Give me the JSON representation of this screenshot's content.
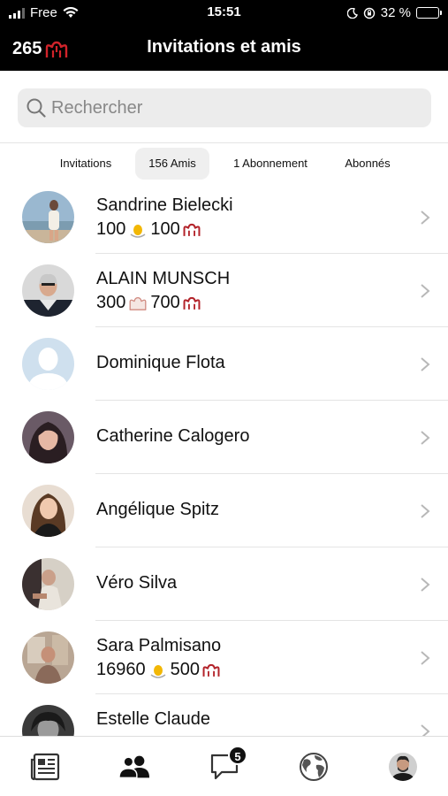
{
  "status_bar": {
    "carrier": "Free",
    "time": "15:51",
    "battery_percent": "32 %",
    "battery_level": 0.32
  },
  "header": {
    "coin_count": "265",
    "title": "Invitations et amis"
  },
  "search": {
    "placeholder": "Rechercher",
    "value": ""
  },
  "tabs": [
    {
      "label": "Invitations",
      "active": false
    },
    {
      "label": "156 Amis",
      "active": true
    },
    {
      "label": "1 Abonnement",
      "active": false
    },
    {
      "label": "Abonnés",
      "active": false
    }
  ],
  "friends": [
    {
      "name": "Sandrine Bielecki",
      "stat1": "100",
      "stat1_icon": "hand-wave-icon",
      "stat2": "100",
      "stat2_icon": "crown-icon"
    },
    {
      "name": "ALAIN MUNSCH",
      "stat1": "300",
      "stat1_icon": "crown-outline-icon",
      "stat2": "700",
      "stat2_icon": "crown-icon"
    },
    {
      "name": "Dominique Flota"
    },
    {
      "name": "Catherine Calogero"
    },
    {
      "name": "Angélique Spitz"
    },
    {
      "name": "Véro Silva"
    },
    {
      "name": "Sara Palmisano",
      "stat1": "16960",
      "stat1_icon": "hand-wave-icon",
      "stat2": "500",
      "stat2_icon": "crown-icon"
    },
    {
      "name": "Estelle Claude"
    }
  ],
  "tabbar": {
    "items": [
      "news-icon",
      "friends-icon",
      "messages-icon",
      "globe-icon",
      "profile-avatar"
    ],
    "messages_badge": "5",
    "active": "friends-icon"
  },
  "colors": {
    "brand_red": "#b3232a",
    "hand_yellow": "#f2b705"
  }
}
